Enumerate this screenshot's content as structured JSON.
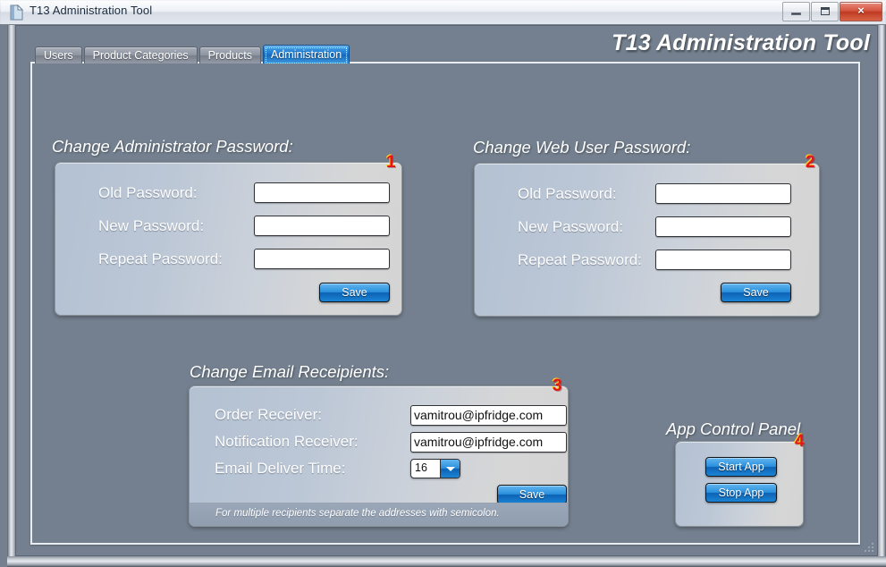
{
  "window": {
    "title": "T13 Administration Tool",
    "icon": "app-document-icon",
    "buttons": {
      "minimize": "minimize-icon",
      "maximize": "maximize-icon",
      "close": "×"
    }
  },
  "tabs": [
    {
      "label": "Users",
      "active": false
    },
    {
      "label": "Product Categories",
      "active": false
    },
    {
      "label": "Products",
      "active": false
    },
    {
      "label": "Administration",
      "active": true
    }
  ],
  "app_heading": "T13 Administration Tool",
  "sections": {
    "admin_password": {
      "title": "Change Administrator Password:",
      "annotation": "1",
      "fields": [
        {
          "label": "Old Password:",
          "value": "",
          "placeholder": ""
        },
        {
          "label": "New Password:",
          "value": "",
          "placeholder": ""
        },
        {
          "label": "Repeat Password:",
          "value": "",
          "placeholder": ""
        }
      ],
      "save_label": "Save"
    },
    "web_user_password": {
      "title": "Change Web User Password:",
      "annotation": "2",
      "fields": [
        {
          "label": "Old Password:",
          "value": "",
          "placeholder": ""
        },
        {
          "label": "New Password:",
          "value": "",
          "placeholder": ""
        },
        {
          "label": "Repeat Password:",
          "value": "",
          "placeholder": ""
        }
      ],
      "save_label": "Save"
    },
    "email_recipients": {
      "title": "Change Email Receipients:",
      "annotation": "3",
      "order_receiver_label": "Order Receiver:",
      "order_receiver_value": "vamitrou@ipfridge.com",
      "notification_receiver_label": "Notification Receiver:",
      "notification_receiver_value": "vamitrou@ipfridge.com",
      "deliver_time_label": "Email Deliver Time:",
      "deliver_time_value": "16",
      "deliver_time_options": [
        "16"
      ],
      "save_label": "Save",
      "hint": "For multiple recipients separate the addresses with semicolon."
    },
    "app_control": {
      "title": "App Control Panel",
      "annotation": "4",
      "start_label": "Start App",
      "stop_label": "Stop App"
    }
  },
  "colors": {
    "window_background": "#74808f",
    "card_gradient_start": "#b3c1d2",
    "card_gradient_end": "#d4d4d4",
    "accent_blue": "#1e79cf",
    "annotation_red": "#e4141b",
    "title_text": "#ffffff"
  }
}
